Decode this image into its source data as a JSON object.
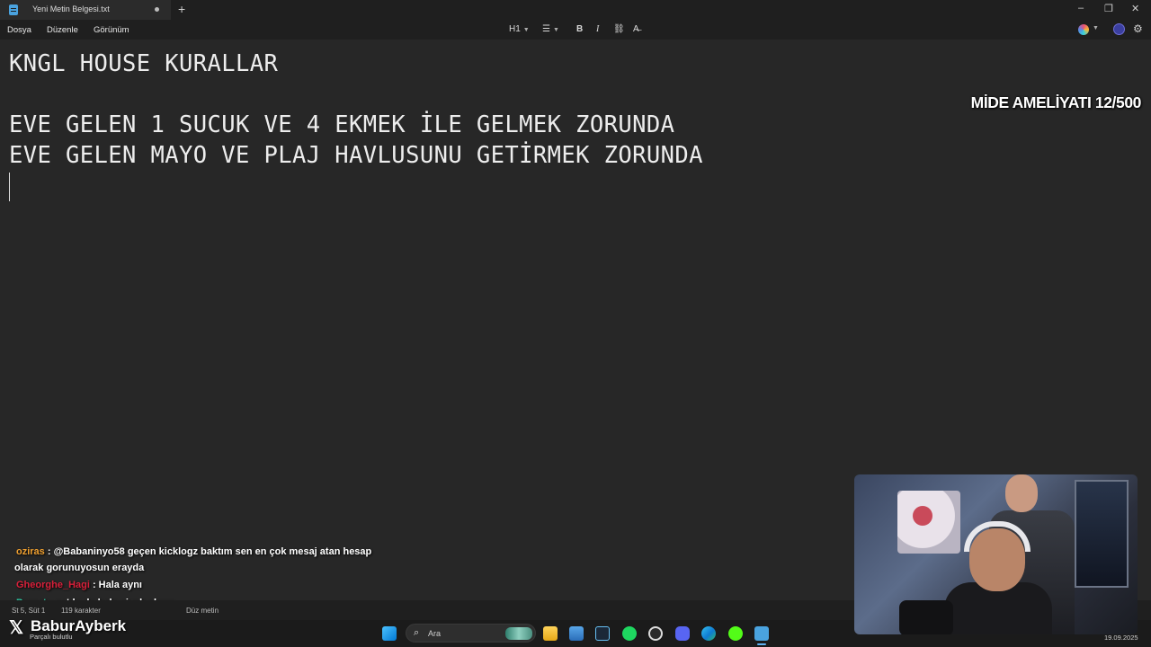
{
  "titlebar": {
    "tab_title": "Yeni Metin Belgesi.txt",
    "new_tab": "+",
    "minimize": "–",
    "restore": "❐",
    "close": "✕"
  },
  "menu": {
    "items": [
      "Dosya",
      "Düzenle",
      "Görünüm"
    ]
  },
  "toolbar": {
    "heading": "H1",
    "list": "☰",
    "bold": "B",
    "italic": "I",
    "link": "⛓",
    "clear_format": "A̶"
  },
  "editor": {
    "lines": [
      "KNGL HOUSE KURALLAR",
      "",
      "EVE GELEN 1 SUCUK VE 4 EKMEK İLE GELMEK ZORUNDA",
      "EVE GELEN MAYO VE PLAJ HAVLUSUNU GETİRMEK ZORUNDA"
    ]
  },
  "overlay": {
    "title": "MİDE AMELİYATI 12/500"
  },
  "chat": [
    {
      "user": "oziras",
      "color": "#f0a030",
      "message": " : @Babaninyo58 geçen kicklogz baktım sen en çok mesaj atan hesap",
      "message2": "olarak gorunuyosun erayda"
    },
    {
      "user": "Gheorghe_Hagi",
      "color": "#d8203a",
      "message": " : Hala aynı"
    },
    {
      "user": "Perest",
      "color": "#2ec4a0",
      "message": " : pc'de de hala siyah ekran"
    }
  ],
  "statusbar": {
    "position": "St 5, Süt 1",
    "chars": "119 karakter",
    "mode": "Düz metin"
  },
  "taskbar": {
    "search_placeholder": "Ara",
    "weather": "Parçalı bulutlu",
    "date": "19.09.2025"
  },
  "watermark": {
    "name": "BaburAyberk"
  },
  "icons": {
    "start": "windows-icon",
    "explorer": "folder-icon",
    "photos": "photos-icon",
    "steam": "steam-icon",
    "spotify": "spotify-icon",
    "obs": "obs-icon",
    "discord": "discord-icon",
    "edge": "edge-icon",
    "kick": "kick-icon",
    "notepad": "notepad-icon"
  }
}
